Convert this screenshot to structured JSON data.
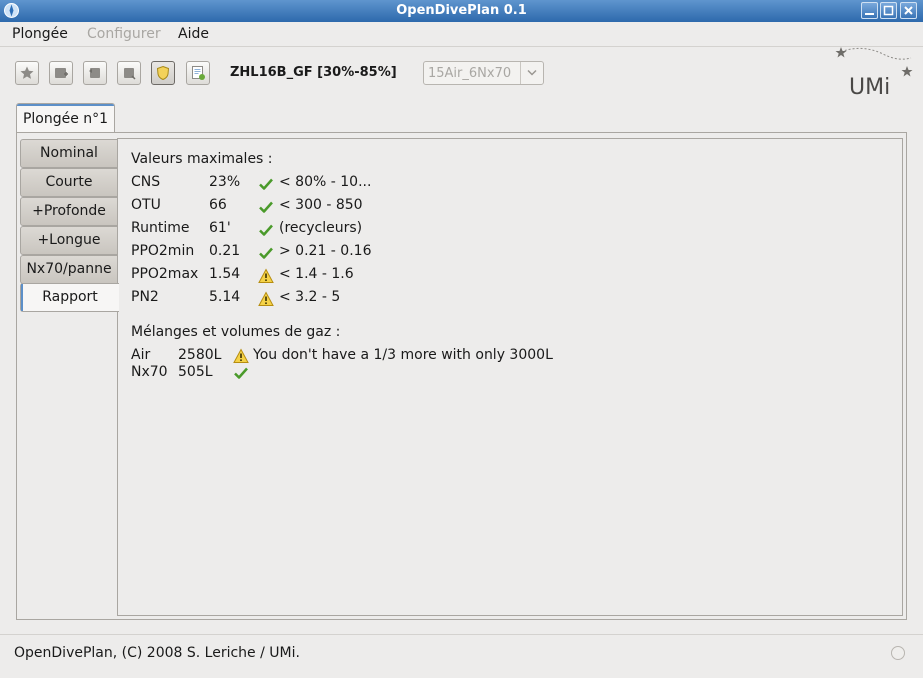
{
  "window": {
    "title": "OpenDivePlan 0.1"
  },
  "menubar": {
    "items": [
      "Plongée",
      "Configurer",
      "Aide"
    ]
  },
  "toolbar": {
    "algorithm_label": "ZHL16B_GF [30%-85%]",
    "gas_select": {
      "value": "15Air_6Nx70"
    }
  },
  "tabs": {
    "outer": [
      "Plongée n°1"
    ]
  },
  "dive_tabs": [
    "Nominal",
    "Courte",
    "+Profonde",
    "+Longue",
    "Nx70/panne",
    "Rapport"
  ],
  "report": {
    "max_title": "Valeurs maximales :",
    "rows": [
      {
        "name": "CNS",
        "value": "23%",
        "status": "ok",
        "text": "< 80% - 10..."
      },
      {
        "name": "OTU",
        "value": "66",
        "status": "ok",
        "text": "< 300 - 850"
      },
      {
        "name": "Runtime",
        "value": "61'",
        "status": "ok",
        "text": "(recycleurs)"
      },
      {
        "name": "PPO2min",
        "value": "0.21",
        "status": "ok",
        "text": "> 0.21 - 0.16"
      },
      {
        "name": "PPO2max",
        "value": "1.54",
        "status": "warn",
        "text": "< 1.4 - 1.6"
      },
      {
        "name": "PN2",
        "value": "5.14",
        "status": "warn",
        "text": "< 3.2 - 5"
      }
    ],
    "gas_title": "Mélanges et volumes de gaz :",
    "gases": [
      {
        "name": "Air",
        "volume": "2580L",
        "status": "warn",
        "text": "You don't have a 1/3 more with only 3000L"
      },
      {
        "name": "Nx70",
        "volume": "505L",
        "status": "ok",
        "text": ""
      }
    ]
  },
  "status": {
    "text": "OpenDivePlan, (C) 2008 S. Leriche / UMi."
  },
  "logo": {
    "text": "UMi"
  }
}
